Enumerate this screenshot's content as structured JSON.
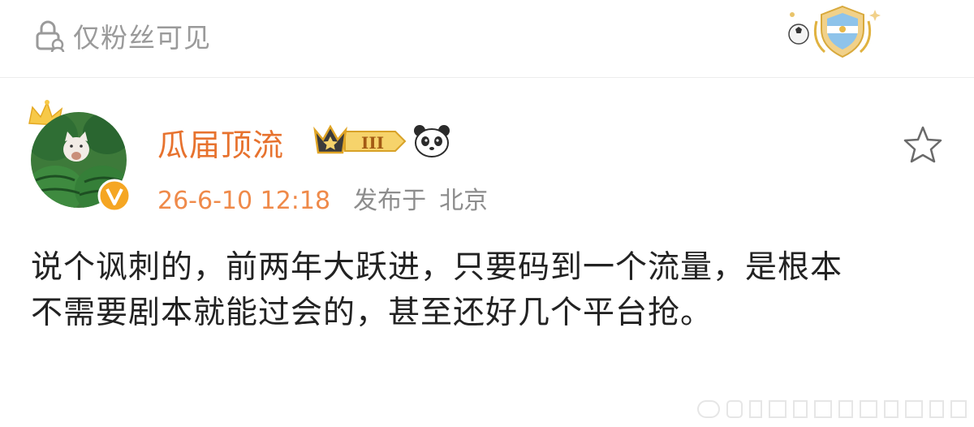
{
  "visibility": {
    "icon": "lock-person-icon",
    "label": "仅粉丝可见"
  },
  "post": {
    "author": {
      "name": "瓜届顶流",
      "avatar": "avatar-watermelon-cat",
      "verified_badge_icon": "v-verified-icon",
      "vip_badge_icon": "vip-level-iii-icon",
      "emoji_icon": "panda-face-icon"
    },
    "timestamp": "26-6-10 12:18",
    "posted_label": "发布于",
    "location": "北京",
    "favorite_icon": "star-outline-icon",
    "text_lines": [
      "说个讽刺的，前两年大跃进，只要码到一个流量，是根本",
      "不需要剧本就能过会的，甚至还好几个平台抢。"
    ]
  },
  "colors": {
    "username": "#e7722e",
    "timestamp": "#ef8a4a",
    "muted": "#8d8d8d",
    "body": "#222222"
  }
}
